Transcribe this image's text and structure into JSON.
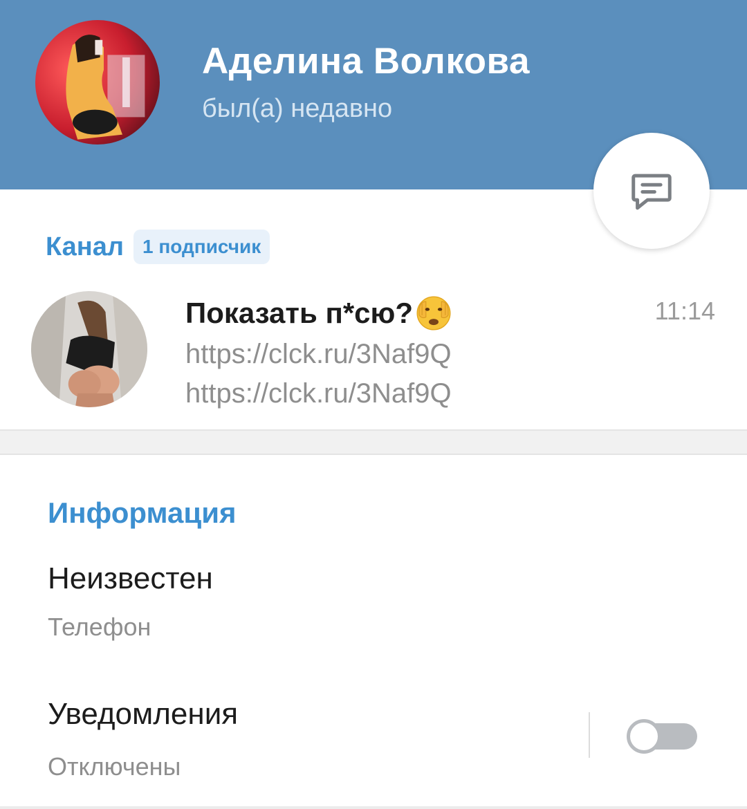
{
  "profile": {
    "name": "Аделина Волкова",
    "status": "был(а) недавно",
    "avatar_icon": "profile-photo"
  },
  "fab": {
    "icon": "message-icon"
  },
  "channel": {
    "title": "Канал",
    "subscribers_badge": "1 подписчик",
    "post": {
      "title": "Показать п*сю?",
      "emoji": "face-with-hand-over-eyes-emoji",
      "time": "11:14",
      "lines": [
        "https://clck.ru/3Naf9Q",
        "https://clck.ru/3Naf9Q"
      ]
    }
  },
  "info": {
    "title": "Информация",
    "phone": {
      "value": "Неизвестен",
      "label": "Телефон"
    },
    "notifications": {
      "value": "Уведомления",
      "label": "Отключены",
      "enabled": false
    }
  },
  "colors": {
    "header": "#5b8fbd",
    "accent": "#3c8fd0",
    "text": "#1c1c1c",
    "secondary": "#8e8e8e"
  }
}
